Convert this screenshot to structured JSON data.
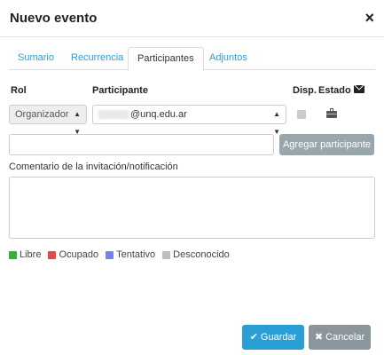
{
  "dialog": {
    "title": "Nuevo evento",
    "close_icon": "×"
  },
  "tabs": [
    {
      "label": "Sumario"
    },
    {
      "label": "Recurrencia"
    },
    {
      "label": "Participantes"
    },
    {
      "label": "Adjuntos"
    }
  ],
  "active_tab": "Participantes",
  "table": {
    "headers": {
      "rol": "Rol",
      "participante": "Participante",
      "disp": "Disp.",
      "estado": "Estado"
    },
    "row": {
      "rol": "Organizador",
      "participante": "@unq.edu.ar"
    }
  },
  "add": {
    "button_label": "Agregar participante",
    "input_value": ""
  },
  "comment": {
    "label": "Comentario de la invitación/notificación",
    "value": ""
  },
  "legend": [
    {
      "label": "Libre",
      "color": "#34b233"
    },
    {
      "label": "Ocupado",
      "color": "#e8464b"
    },
    {
      "label": "Tentativo",
      "color": "#7b7ef0"
    },
    {
      "label": "Desconocido",
      "color": "#bdbdbd"
    }
  ],
  "footer": {
    "save_label": "Guardar",
    "cancel_label": "Cancelar"
  },
  "colors": {
    "accent": "#2a9fd6",
    "add_button": "#99a6ae",
    "cancel_button": "#8a959c"
  },
  "icons": {
    "close": "close-icon",
    "mail": "envelope-icon",
    "status": "briefcase-icon",
    "save": "check-icon",
    "cancel": "x-icon"
  }
}
